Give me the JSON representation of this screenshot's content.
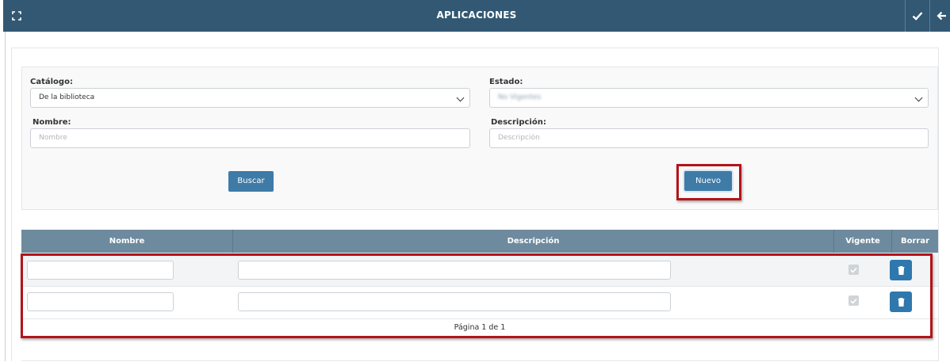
{
  "header": {
    "title": "APLICACIONES",
    "icons": [
      "expand-icon",
      "check-icon",
      "back-arrow-icon"
    ]
  },
  "filters": {
    "catalogo": {
      "label": "Catálogo:",
      "value": "De la biblioteca"
    },
    "estado": {
      "label": "Estado:",
      "value": "No Vigentes"
    },
    "nombre": {
      "label": "Nombre:",
      "placeholder": "Nombre"
    },
    "descripcion": {
      "label": "Descripción:",
      "placeholder": "Descripción"
    },
    "buscar_label": "Buscar",
    "nuevo_label": "Nuevo"
  },
  "grid": {
    "columns": [
      "Nombre",
      "Descripción",
      "Vigente",
      "Borrar"
    ],
    "rows": [
      {
        "nombre": "",
        "descripcion": "",
        "vigente": true
      },
      {
        "nombre": "",
        "descripcion": "",
        "vigente": true
      }
    ],
    "pager": "Página 1 de 1"
  },
  "colors": {
    "header_bg": "#325873",
    "grid_header_bg": "#6e8a9e",
    "button": "#3f7ba7",
    "highlight": "#b4141a"
  }
}
